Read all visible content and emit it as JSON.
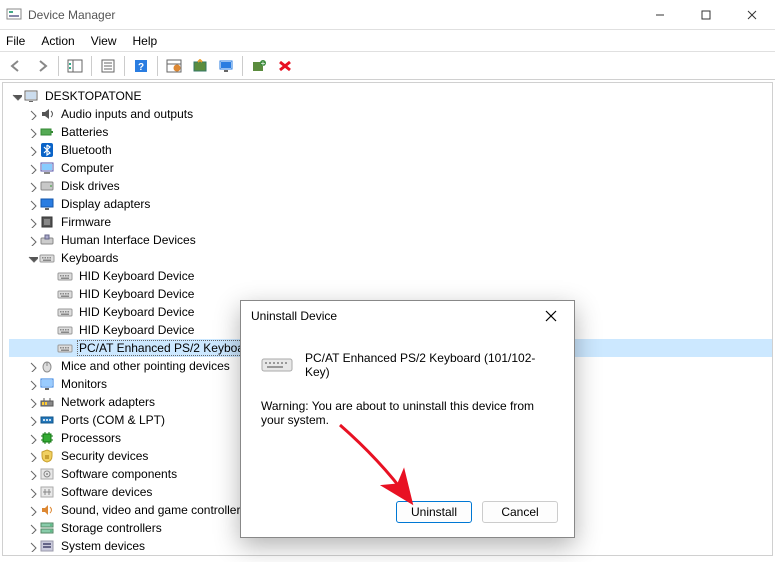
{
  "window": {
    "title": "Device Manager"
  },
  "menubar": [
    "File",
    "Action",
    "View",
    "Help"
  ],
  "tree": {
    "root": "DESKTOPATONE",
    "categories": [
      {
        "label": "Audio inputs and outputs",
        "icon": "audio",
        "expanded": false
      },
      {
        "label": "Batteries",
        "icon": "battery",
        "expanded": false
      },
      {
        "label": "Bluetooth",
        "icon": "bluetooth",
        "expanded": false
      },
      {
        "label": "Computer",
        "icon": "computer",
        "expanded": false
      },
      {
        "label": "Disk drives",
        "icon": "disk",
        "expanded": false
      },
      {
        "label": "Display adapters",
        "icon": "display",
        "expanded": false
      },
      {
        "label": "Firmware",
        "icon": "firmware",
        "expanded": false
      },
      {
        "label": "Human Interface Devices",
        "icon": "hid",
        "expanded": false
      },
      {
        "label": "Keyboards",
        "icon": "keyboard",
        "expanded": true,
        "children": [
          {
            "label": "HID Keyboard Device",
            "icon": "keyboard"
          },
          {
            "label": "HID Keyboard Device",
            "icon": "keyboard"
          },
          {
            "label": "HID Keyboard Device",
            "icon": "keyboard"
          },
          {
            "label": "HID Keyboard Device",
            "icon": "keyboard"
          },
          {
            "label": "PC/AT Enhanced PS/2 Keyboard (101/102-Key)",
            "icon": "keyboard",
            "selected": true
          }
        ]
      },
      {
        "label": "Mice and other pointing devices",
        "icon": "mouse",
        "expanded": false
      },
      {
        "label": "Monitors",
        "icon": "monitor",
        "expanded": false
      },
      {
        "label": "Network adapters",
        "icon": "network",
        "expanded": false
      },
      {
        "label": "Ports (COM & LPT)",
        "icon": "port",
        "expanded": false
      },
      {
        "label": "Processors",
        "icon": "cpu",
        "expanded": false
      },
      {
        "label": "Security devices",
        "icon": "security",
        "expanded": false
      },
      {
        "label": "Software components",
        "icon": "swcomp",
        "expanded": false
      },
      {
        "label": "Software devices",
        "icon": "swdev",
        "expanded": false
      },
      {
        "label": "Sound, video and game controllers",
        "icon": "sound",
        "expanded": false
      },
      {
        "label": "Storage controllers",
        "icon": "storage",
        "expanded": false
      },
      {
        "label": "System devices",
        "icon": "system",
        "expanded": false
      }
    ]
  },
  "dialog": {
    "title": "Uninstall Device",
    "device_name": "PC/AT Enhanced PS/2 Keyboard (101/102-Key)",
    "warning": "Warning: You are about to uninstall this device from your system.",
    "uninstall_label": "Uninstall",
    "cancel_label": "Cancel"
  },
  "colors": {
    "selection": "#cce8ff",
    "arrow": "#e81123"
  }
}
